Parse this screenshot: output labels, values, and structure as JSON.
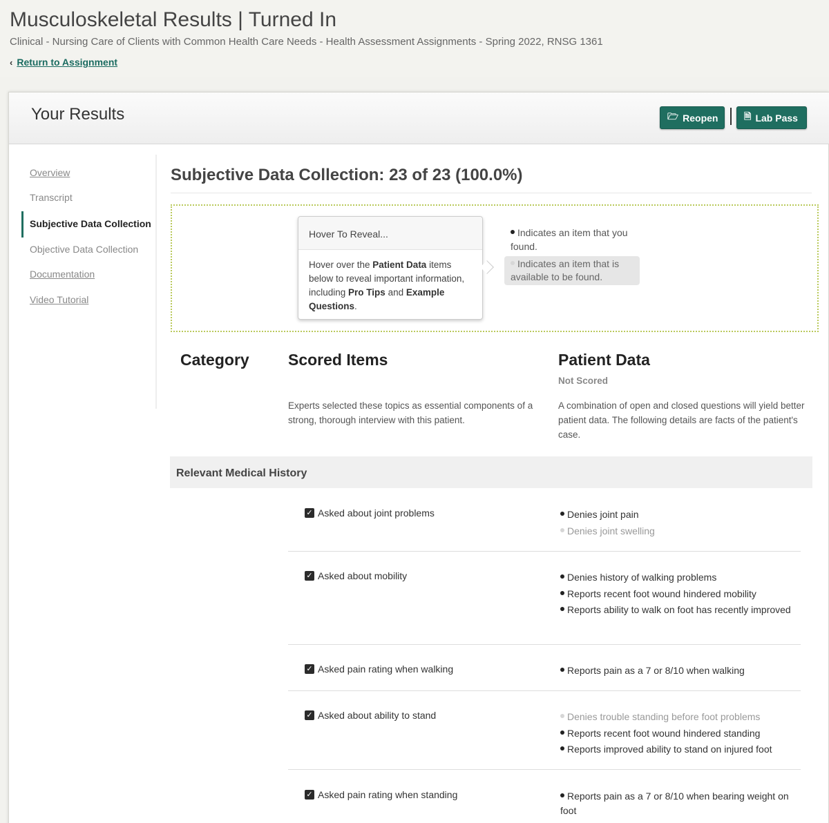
{
  "header": {
    "title": "Musculoskeletal Results | Turned In",
    "breadcrumb": "Clinical - Nursing Care of Clients with Common Health Care Needs - Health Assessment Assignments - Spring 2022, RNSG 1361",
    "return_link": "Return to Assignment"
  },
  "card": {
    "title": "Your Results",
    "reopen_label": "Reopen",
    "lab_pass_label": "Lab Pass"
  },
  "sidebar": {
    "items": [
      {
        "label": "Overview"
      },
      {
        "label": "Transcript"
      },
      {
        "label": "Subjective Data Collection"
      },
      {
        "label": "Objective Data Collection"
      },
      {
        "label": "Documentation"
      },
      {
        "label": "Video Tutorial"
      }
    ]
  },
  "section": {
    "title": "Subjective Data Collection: 23 of 23 (100.0%)"
  },
  "legend": {
    "tooltip_title": "Hover To Reveal...",
    "tooltip_part1": "Hover over the ",
    "tooltip_bold1": "Patient Data",
    "tooltip_part2": " items below to reveal important information, including ",
    "tooltip_bold2": "Pro Tips",
    "tooltip_part3": " and ",
    "tooltip_bold3": "Example Questions",
    "tooltip_part4": ".",
    "found_text": "Indicates an item that you found.",
    "available_text": "Indicates an item that is available to be found."
  },
  "columns": {
    "category": "Category",
    "scored_items": "Scored Items",
    "patient_data": "Patient Data",
    "not_scored": "Not Scored",
    "scored_desc": "Experts selected these topics as essential components of a strong, thorough interview with this patient.",
    "patient_desc": "A combination of open and closed questions will yield better patient data. The following details are facts of the patient's case."
  },
  "category_name": "Relevant Medical History",
  "rows": [
    {
      "item": "Asked about joint problems",
      "data": [
        {
          "text": "Denies joint pain",
          "found": true
        },
        {
          "text": "Denies joint swelling",
          "found": false
        }
      ]
    },
    {
      "item": "Asked about mobility",
      "data": [
        {
          "text": "Denies history of walking problems",
          "found": true
        },
        {
          "text": "Reports recent foot wound hindered mobility",
          "found": true
        },
        {
          "text": "Reports ability to walk on foot has recently improved",
          "found": true
        }
      ]
    },
    {
      "item": "Asked pain rating when walking",
      "data": [
        {
          "text": "Reports pain as a 7 or 8/10 when walking",
          "found": true
        }
      ]
    },
    {
      "item": "Asked about ability to stand",
      "data": [
        {
          "text": "Denies trouble standing before foot problems",
          "found": false
        },
        {
          "text": "Reports recent foot wound hindered standing",
          "found": true
        },
        {
          "text": "Reports improved ability to stand on injured foot",
          "found": true
        }
      ]
    },
    {
      "item": "Asked pain rating when standing",
      "data": [
        {
          "text": "Reports pain as a 7 or 8/10 when bearing weight on foot",
          "found": true
        }
      ]
    }
  ]
}
